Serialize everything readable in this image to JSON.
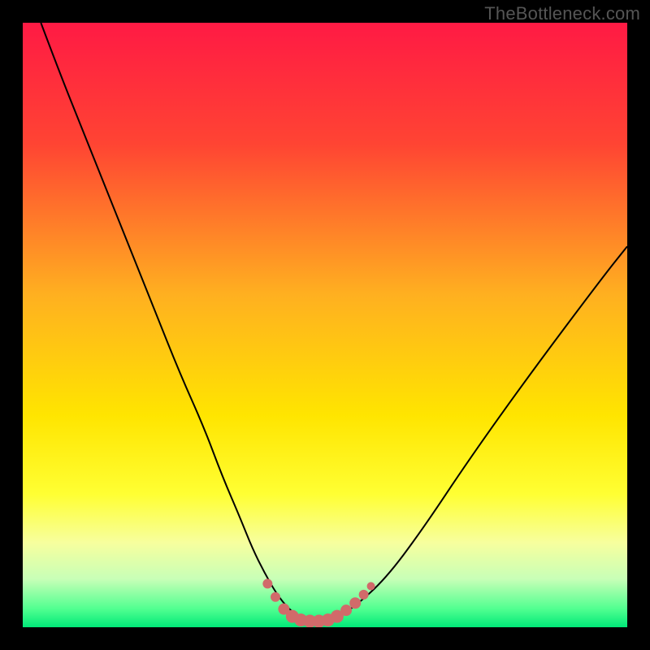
{
  "watermark": "TheBottleneck.com",
  "chart_data": {
    "type": "line",
    "title": "",
    "xlabel": "",
    "ylabel": "",
    "xlim": [
      0,
      100
    ],
    "ylim": [
      0,
      100
    ],
    "background_gradient_stops": [
      {
        "offset": 0,
        "color": "#ff1a44"
      },
      {
        "offset": 20,
        "color": "#ff4433"
      },
      {
        "offset": 45,
        "color": "#ffb020"
      },
      {
        "offset": 65,
        "color": "#ffe500"
      },
      {
        "offset": 78,
        "color": "#ffff33"
      },
      {
        "offset": 86,
        "color": "#f7ff9e"
      },
      {
        "offset": 92,
        "color": "#c8ffb7"
      },
      {
        "offset": 97,
        "color": "#50ff90"
      },
      {
        "offset": 100,
        "color": "#00e878"
      }
    ],
    "series": [
      {
        "name": "bottleneck-curve",
        "color": "#000000",
        "width": 2,
        "x": [
          3,
          6,
          10,
          14,
          18,
          22,
          26,
          30,
          33,
          36,
          38,
          40,
          42,
          44,
          46,
          48,
          50,
          52,
          55,
          60,
          66,
          74,
          84,
          96,
          100
        ],
        "y": [
          100,
          92,
          82,
          72,
          62,
          52,
          42,
          33,
          25,
          18,
          13,
          9,
          5.5,
          3,
          1.6,
          1.0,
          1.0,
          1.6,
          3.5,
          8,
          16,
          28,
          42,
          58,
          63
        ]
      }
    ],
    "marker_overlay": {
      "name": "highlight-band",
      "color": "#d16a6a",
      "points": [
        {
          "x": 40.5,
          "y": 7.2,
          "r": 6
        },
        {
          "x": 41.8,
          "y": 5.0,
          "r": 6
        },
        {
          "x": 43.2,
          "y": 3.0,
          "r": 7
        },
        {
          "x": 44.6,
          "y": 1.8,
          "r": 8
        },
        {
          "x": 46.0,
          "y": 1.2,
          "r": 8
        },
        {
          "x": 47.5,
          "y": 1.0,
          "r": 8
        },
        {
          "x": 49.0,
          "y": 1.0,
          "r": 8
        },
        {
          "x": 50.5,
          "y": 1.2,
          "r": 8
        },
        {
          "x": 52.0,
          "y": 1.8,
          "r": 8
        },
        {
          "x": 53.5,
          "y": 2.8,
          "r": 7
        },
        {
          "x": 55.0,
          "y": 4.0,
          "r": 7
        },
        {
          "x": 56.4,
          "y": 5.4,
          "r": 6
        },
        {
          "x": 57.6,
          "y": 6.8,
          "r": 5
        }
      ]
    }
  }
}
